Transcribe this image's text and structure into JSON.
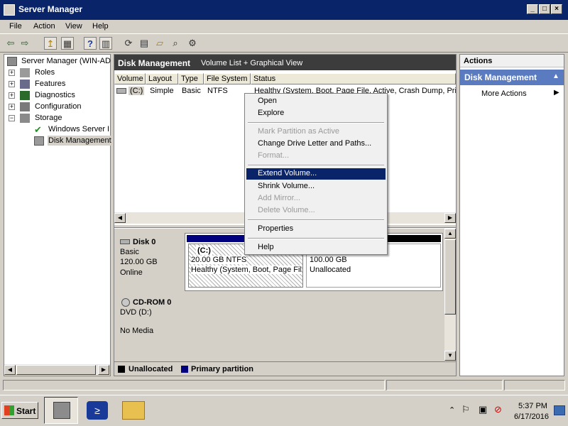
{
  "window": {
    "title": "Server Manager"
  },
  "menu": [
    "File",
    "Action",
    "View",
    "Help"
  ],
  "tree": {
    "root": "Server Manager (WIN-AD",
    "items": [
      "Roles",
      "Features",
      "Diagnostics",
      "Configuration",
      "Storage"
    ],
    "storage_children": [
      "Windows Server B",
      "Disk Management"
    ]
  },
  "center": {
    "title": "Disk Management",
    "subtitle": "Volume List + Graphical View",
    "columns": [
      "Volume",
      "Layout",
      "Type",
      "File System",
      "Status"
    ],
    "row": {
      "volume": "(C:)",
      "layout": "Simple",
      "type": "Basic",
      "fs": "NTFS",
      "status": "Healthy (System, Boot, Page File, Active, Crash Dump, Prin"
    }
  },
  "disks": [
    {
      "name": "Disk 0",
      "type": "Basic",
      "size": "120.00 GB",
      "status": "Online"
    },
    {
      "name": "CD-ROM 0",
      "type": "DVD (D:)",
      "size": "",
      "status": "No Media"
    }
  ],
  "partitions": {
    "c": {
      "label": "(C:)",
      "size": "20.00 GB NTFS",
      "status": "Healthy (System, Boot, Page Fil"
    },
    "unalloc": {
      "size": "100.00 GB",
      "status": "Unallocated"
    }
  },
  "legend": {
    "unallocated": "Unallocated",
    "primary": "Primary partition"
  },
  "actions": {
    "header": "Actions",
    "section": "Disk Management",
    "more": "More Actions"
  },
  "context_menu": [
    {
      "label": "Open",
      "state": "normal"
    },
    {
      "label": "Explore",
      "state": "normal"
    },
    {
      "label": "Mark Partition as Active",
      "state": "disabled"
    },
    {
      "label": "Change Drive Letter and Paths...",
      "state": "normal"
    },
    {
      "label": "Format...",
      "state": "disabled"
    },
    {
      "label": "Extend Volume...",
      "state": "highlighted"
    },
    {
      "label": "Shrink Volume...",
      "state": "normal"
    },
    {
      "label": "Add Mirror...",
      "state": "disabled"
    },
    {
      "label": "Delete Volume...",
      "state": "disabled"
    },
    {
      "label": "Properties",
      "state": "normal"
    },
    {
      "label": "Help",
      "state": "normal"
    }
  ],
  "taskbar": {
    "start": "Start",
    "time": "5:37 PM",
    "date": "6/17/2016"
  },
  "colors": {
    "titlebar": "#0a246a",
    "primary_partition": "#00007f",
    "unallocated": "#000000",
    "highlight": "#0a246a",
    "action_header": "#5a7bbf"
  }
}
